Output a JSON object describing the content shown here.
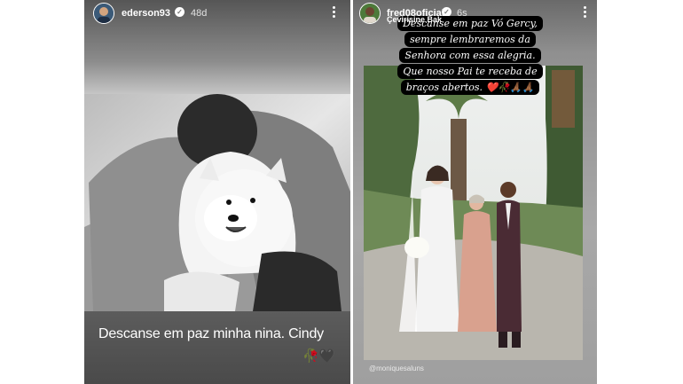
{
  "left_story": {
    "username": "ederson93",
    "time": "48d",
    "caption": "Descanse em paz minha nina. Cindy",
    "emojis": "🥀🖤",
    "avatar_icon": "profile-photo-icon",
    "verified_icon": "verified-badge-icon"
  },
  "right_story": {
    "username": "fred08oficial",
    "time": "6s",
    "subtitle": "Çevirisine Bak",
    "caption_lines": [
      "Descanse em paz Vó Gercy,",
      "sempre lembraremos da",
      "Senhora com essa alegria.",
      "Que nosso Pai te receba de",
      "braços abertos. ❤️🥀🙏🏾🙏🏾"
    ],
    "photo_credit": "@moniquesaluns",
    "avatar_icon": "profile-photo-icon",
    "verified_icon": "verified-badge-icon"
  },
  "colors": {
    "caption_bg": "#000000",
    "caption_text": "#ffffff",
    "bar_bg": "#4f4f4f"
  }
}
